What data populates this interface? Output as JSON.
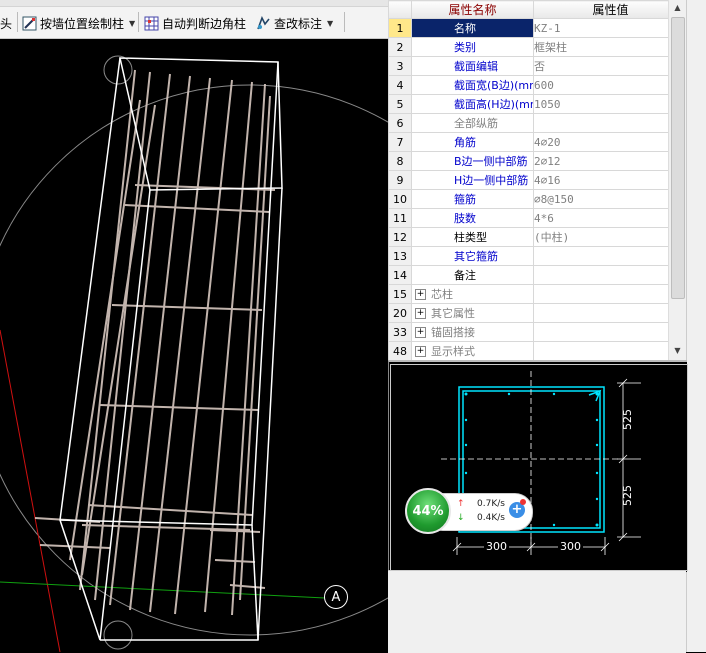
{
  "toolbar": {
    "item_cut_label": "头",
    "draw_by_wall_label": "按墙位置绘制柱",
    "auto_corner_label": "自动判断边角柱",
    "edit_annotation_label": "查改标注"
  },
  "property_grid": {
    "header_name": "属性名称",
    "header_value": "属性值",
    "rows": [
      {
        "num": "1",
        "name": "名称",
        "value": "KZ-1"
      },
      {
        "num": "2",
        "name": "类别",
        "value": "框架柱"
      },
      {
        "num": "3",
        "name": "截面编辑",
        "value": "否"
      },
      {
        "num": "4",
        "name": "截面宽(B边)(mm)",
        "value": "600"
      },
      {
        "num": "5",
        "name": "截面高(H边)(mm)",
        "value": "1050"
      },
      {
        "num": "6",
        "name": "全部纵筋",
        "value": ""
      },
      {
        "num": "7",
        "name": "角筋",
        "value": "4⌀20"
      },
      {
        "num": "8",
        "name": "B边一侧中部筋",
        "value": "2⌀12"
      },
      {
        "num": "9",
        "name": "H边一侧中部筋",
        "value": "4⌀16"
      },
      {
        "num": "10",
        "name": "箍筋",
        "value": "⌀8@150"
      },
      {
        "num": "11",
        "name": "肢数",
        "value": "4*6"
      },
      {
        "num": "12",
        "name": "柱类型",
        "value": "(中柱)"
      },
      {
        "num": "13",
        "name": "其它箍筋",
        "value": ""
      },
      {
        "num": "14",
        "name": "备注",
        "value": ""
      },
      {
        "num": "15",
        "name": "芯柱",
        "value": ""
      },
      {
        "num": "20",
        "name": "其它属性",
        "value": ""
      },
      {
        "num": "33",
        "name": "锚固搭接",
        "value": ""
      },
      {
        "num": "48",
        "name": "显示样式",
        "value": ""
      }
    ]
  },
  "section_preview": {
    "dim_top": "525",
    "dim_bottom": "525",
    "dim_left": "300",
    "dim_right": "300"
  },
  "net_monitor": {
    "percent": "44%",
    "upload": "0.7K/s",
    "download": "0.4K/s"
  },
  "canvas": {
    "axis_label": "A"
  },
  "colors": {
    "selected_row_bg": "#0a246a",
    "blue_text": "#0000cc",
    "gray_text": "#808080",
    "header_red": "#8b0000",
    "rebar_color": "#d8c8c0",
    "section_outline": "#00e5ff"
  }
}
